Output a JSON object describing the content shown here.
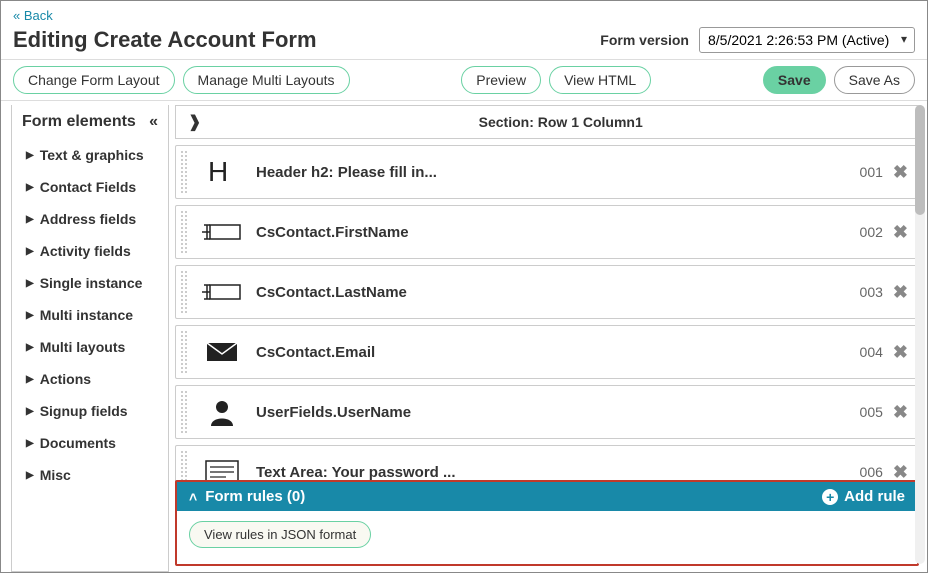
{
  "nav": {
    "back": "« Back"
  },
  "header": {
    "title": "Editing Create Account Form",
    "version_label": "Form version",
    "version_selected": "8/5/2021 2:26:53 PM (Active)"
  },
  "toolbar": {
    "change_layout": "Change Form Layout",
    "manage_layouts": "Manage Multi Layouts",
    "preview": "Preview",
    "view_html": "View HTML",
    "save": "Save",
    "save_as": "Save As"
  },
  "sidebar": {
    "title": "Form elements",
    "items": [
      {
        "label": "Text & graphics"
      },
      {
        "label": "Contact Fields"
      },
      {
        "label": "Address fields"
      },
      {
        "label": "Activity fields"
      },
      {
        "label": "Single instance"
      },
      {
        "label": "Multi instance"
      },
      {
        "label": "Multi layouts"
      },
      {
        "label": "Actions"
      },
      {
        "label": "Signup fields"
      },
      {
        "label": "Documents"
      },
      {
        "label": "Misc"
      }
    ]
  },
  "section": {
    "title": "Section: Row 1 Column1"
  },
  "fields": [
    {
      "icon": "header",
      "label": "Header h2: Please fill in...",
      "num": "001"
    },
    {
      "icon": "textbox",
      "label": "CsContact.FirstName",
      "num": "002"
    },
    {
      "icon": "textbox",
      "label": "CsContact.LastName",
      "num": "003"
    },
    {
      "icon": "email",
      "label": "CsContact.Email",
      "num": "004"
    },
    {
      "icon": "user",
      "label": "UserFields.UserName",
      "num": "005"
    },
    {
      "icon": "textarea",
      "label": "Text Area: Your password ...",
      "num": "006"
    }
  ],
  "rules": {
    "title": "Form rules (0)",
    "add": "Add rule",
    "view_json": "View rules in JSON format"
  }
}
